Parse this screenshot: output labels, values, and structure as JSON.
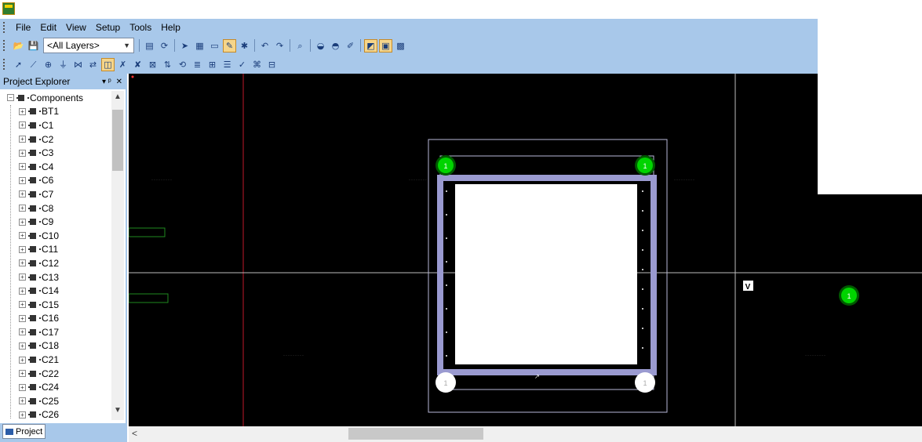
{
  "menu": [
    "File",
    "Edit",
    "View",
    "Setup",
    "Tools",
    "Help"
  ],
  "toolbar1": {
    "layer_select_value": "<All Layers>"
  },
  "explorer": {
    "title": "Project Explorer",
    "pin_label": "▾ ᵖ",
    "close_label": "✕",
    "root": "Components",
    "items": [
      "BT1",
      "C1",
      "C2",
      "C3",
      "C4",
      "C6",
      "C7",
      "C8",
      "C9",
      "C10",
      "C11",
      "C12",
      "C13",
      "C14",
      "C15",
      "C16",
      "C17",
      "C18",
      "C21",
      "C22",
      "C24",
      "C25",
      "C26"
    ],
    "tab": "Project"
  },
  "canvas": {
    "label_V": "V",
    "pin_label": "1",
    "colors": {
      "background": "#000000",
      "board_outline": "#b7b7d8",
      "crosshair": "#bdbdbd",
      "red_line": "#c0182a",
      "pad_green": "#00d400",
      "pad_white": "#ffffff",
      "green_rect": "#1f8a1f"
    }
  },
  "icons": [
    "open-icon",
    "save-icon",
    "properties-icon",
    "refresh-icon",
    "route-icon",
    "grid-icon",
    "display-icon",
    "pencil-icon",
    "component-icon",
    "undo-icon",
    "redo-icon",
    "zoom-icon",
    "layer-icon",
    "verify-icon",
    "brush-icon",
    "view-icon",
    "board-icon",
    "settings-icon"
  ]
}
